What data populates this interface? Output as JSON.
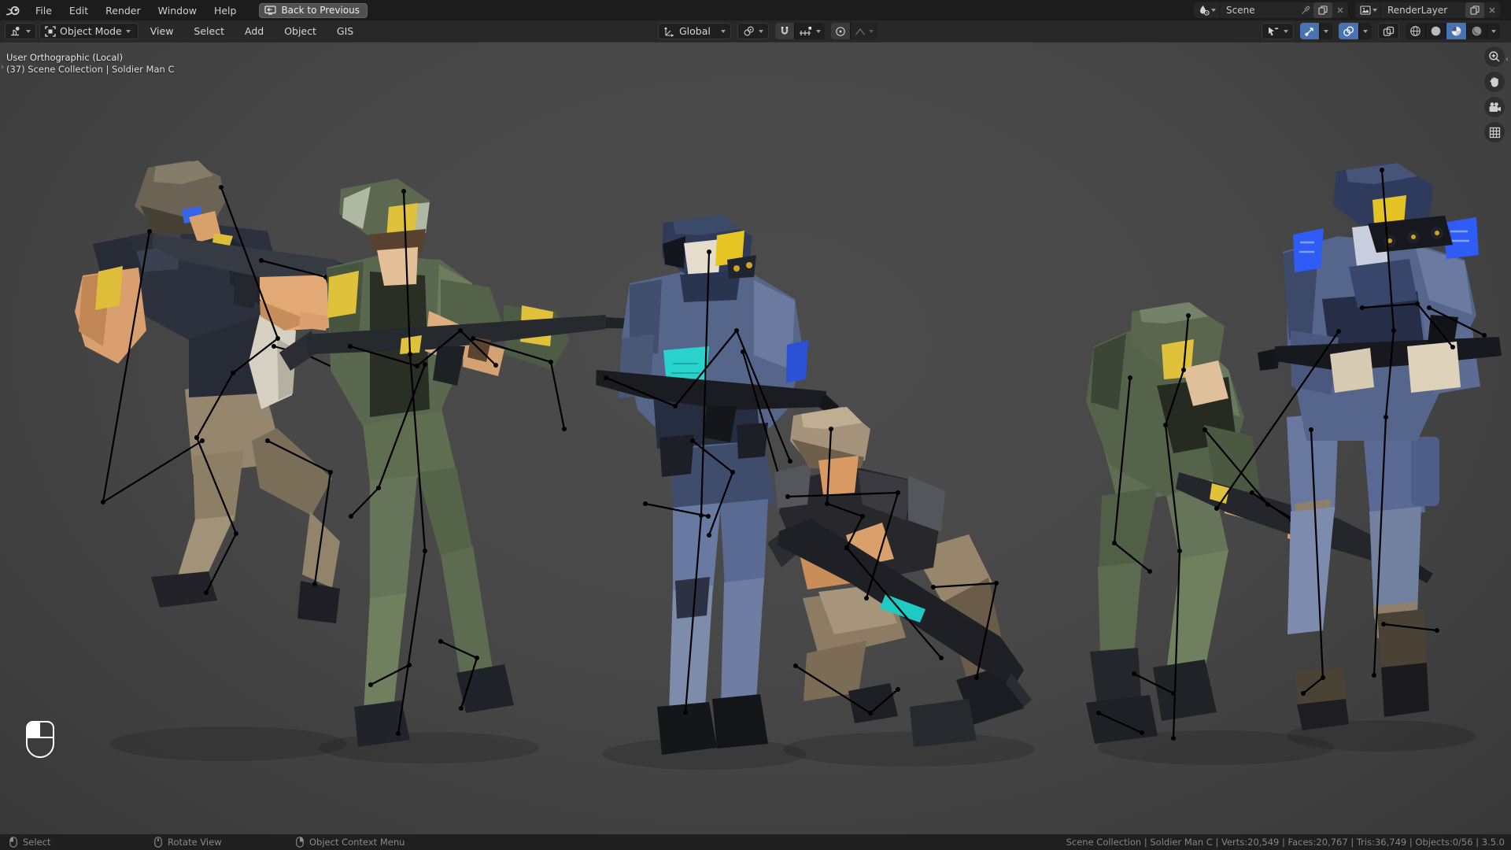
{
  "topbar": {
    "menus": [
      "File",
      "Edit",
      "Render",
      "Window",
      "Help"
    ],
    "back_button_label": "Back to Previous",
    "scene": {
      "label": "Scene"
    },
    "render_layer": {
      "label": "RenderLayer"
    }
  },
  "viewport_header": {
    "mode": "Object Mode",
    "menus": [
      "View",
      "Select",
      "Add",
      "Object",
      "GIS"
    ],
    "orientation": "Global"
  },
  "viewport": {
    "overlay_line1": "User Orthographic (Local)",
    "overlay_line2": "(37) Scene Collection | Soldier Man C"
  },
  "statusbar": {
    "hint_select": "Select",
    "hint_rotate": "Rotate View",
    "hint_context": "Object Context Menu",
    "stats": "Scene Collection | Soldier Man C | Verts:20,549 | Faces:20,767 | Tris:36,749 | Objects:0/56 | 3.5.0"
  },
  "colors": {
    "accent_blue": "#4772b3",
    "patch_yellow": "#e2c23c",
    "patch_cyan": "#2bd4cd",
    "patch_blue": "#2e5cf5",
    "armature": "#000000"
  }
}
